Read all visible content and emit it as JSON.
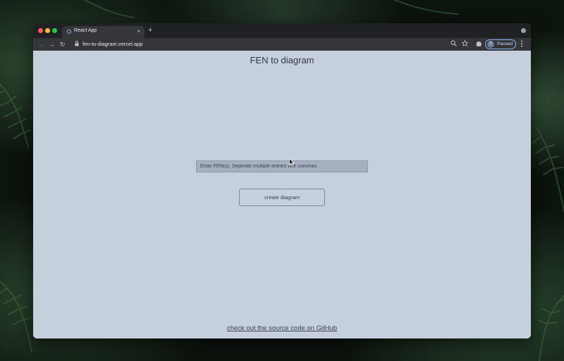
{
  "browser": {
    "tab": {
      "title": "React App",
      "favicon": "react-favicon-icon",
      "close_glyph": "×"
    },
    "new_tab_glyph": "+",
    "address_bar": {
      "url": "fen-to-diagram.vercel.app"
    },
    "nav": {
      "back_glyph": "←",
      "forward_glyph": "→",
      "reload_glyph": "↻"
    },
    "profile": {
      "initial": "T",
      "status": "Paused"
    },
    "icons": [
      "zoom-icon",
      "star-icon",
      "extensions-icon",
      "menu-icon"
    ]
  },
  "page": {
    "title": "FEN to diagram",
    "fen_input": {
      "value": "",
      "placeholder": "Enter FEN(s). Seperate multiple entries with commas."
    },
    "create_button": "create diagram",
    "github_link": "check out the source code on GitHub"
  },
  "colors": {
    "page_background": "#c6cfdc",
    "input_background": "#a6afbd",
    "text": "#323a45",
    "profile_accent": "#8ab4f8"
  }
}
